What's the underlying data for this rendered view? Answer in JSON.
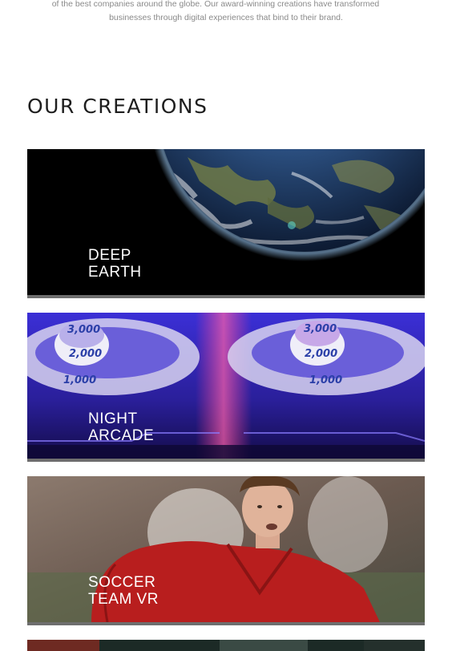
{
  "intro": {
    "line1": "of the best companies around the globe. Our award-winning creations have transformed",
    "line2": "businesses through digital experiences that bind to their brand."
  },
  "section": {
    "title": "OUR CREATIONS"
  },
  "cards": [
    {
      "line1": "DEEP",
      "line2": "EARTH"
    },
    {
      "line1": "NIGHT",
      "line2": "ARCADE"
    },
    {
      "line1": "SOCCER",
      "line2": "TEAM VR"
    }
  ],
  "scores": [
    "3,000",
    "2,000",
    "1,000"
  ]
}
